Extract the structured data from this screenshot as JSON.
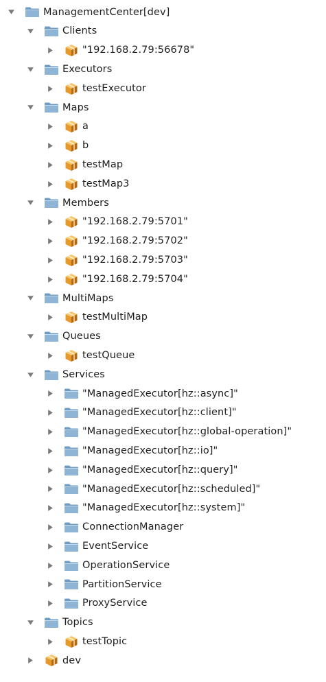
{
  "tree": {
    "root": {
      "label": "ManagementCenter[dev]",
      "groups": [
        {
          "label": "Clients",
          "items": [
            {
              "label": "\"192.168.2.79:56678\"",
              "icon": "cube-icon"
            }
          ]
        },
        {
          "label": "Executors",
          "items": [
            {
              "label": "testExecutor",
              "icon": "cube-icon"
            }
          ]
        },
        {
          "label": "Maps",
          "items": [
            {
              "label": "a",
              "icon": "cube-icon"
            },
            {
              "label": "b",
              "icon": "cube-icon"
            },
            {
              "label": "testMap",
              "icon": "cube-icon"
            },
            {
              "label": "testMap3",
              "icon": "cube-icon"
            }
          ]
        },
        {
          "label": "Members",
          "items": [
            {
              "label": "\"192.168.2.79:5701\"",
              "icon": "cube-icon"
            },
            {
              "label": "\"192.168.2.79:5702\"",
              "icon": "cube-icon"
            },
            {
              "label": "\"192.168.2.79:5703\"",
              "icon": "cube-icon"
            },
            {
              "label": "\"192.168.2.79:5704\"",
              "icon": "cube-icon"
            }
          ]
        },
        {
          "label": "MultiMaps",
          "items": [
            {
              "label": "testMultiMap",
              "icon": "cube-icon"
            }
          ]
        },
        {
          "label": "Queues",
          "items": [
            {
              "label": "testQueue",
              "icon": "cube-icon"
            }
          ]
        },
        {
          "label": "Services",
          "items": [
            {
              "label": "\"ManagedExecutor[hz::async]\"",
              "icon": "folder-icon"
            },
            {
              "label": "\"ManagedExecutor[hz::client]\"",
              "icon": "folder-icon"
            },
            {
              "label": "\"ManagedExecutor[hz::global-operation]\"",
              "icon": "folder-icon"
            },
            {
              "label": "\"ManagedExecutor[hz::io]\"",
              "icon": "folder-icon"
            },
            {
              "label": "\"ManagedExecutor[hz::query]\"",
              "icon": "folder-icon"
            },
            {
              "label": "\"ManagedExecutor[hz::scheduled]\"",
              "icon": "folder-icon"
            },
            {
              "label": "\"ManagedExecutor[hz::system]\"",
              "icon": "folder-icon"
            },
            {
              "label": "ConnectionManager",
              "icon": "folder-icon"
            },
            {
              "label": "EventService",
              "icon": "folder-icon"
            },
            {
              "label": "OperationService",
              "icon": "folder-icon"
            },
            {
              "label": "PartitionService",
              "icon": "folder-icon"
            },
            {
              "label": "ProxyService",
              "icon": "folder-icon"
            }
          ]
        },
        {
          "label": "Topics",
          "items": [
            {
              "label": "testTopic",
              "icon": "cube-icon"
            }
          ]
        }
      ]
    },
    "siblings": [
      {
        "label": "dev",
        "icon": "cube-icon"
      }
    ],
    "colors": {
      "folder_body": "#8fb5d6",
      "folder_tab": "#6f9cc4",
      "cube_orange": "#e79a2c",
      "cube_dark": "#b66a14",
      "cube_light": "#f7c66a",
      "toggle": "#7a7a7a"
    }
  }
}
